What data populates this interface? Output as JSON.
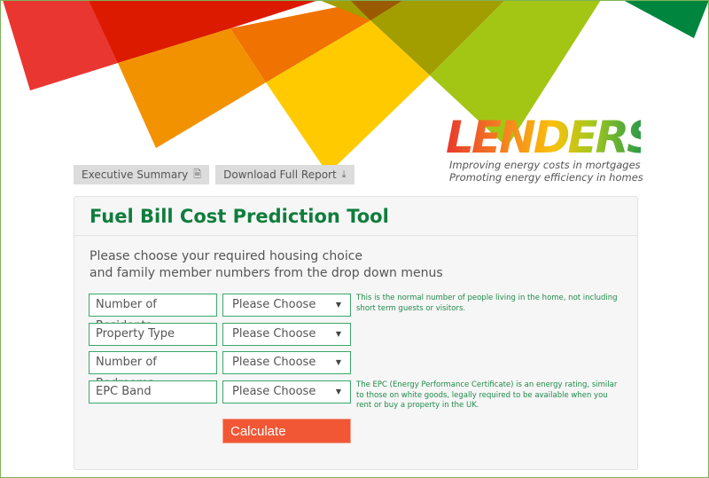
{
  "brand": {
    "name": "LENDERS",
    "tagline_1": "Improving energy costs in mortgages",
    "tagline_2": "Promoting energy efficiency in homes"
  },
  "top_buttons": [
    {
      "label": "Executive Summary",
      "icon": "document-icon"
    },
    {
      "label": "Download Full Report",
      "icon": "download-icon"
    }
  ],
  "tool": {
    "title": "Fuel Bill Cost Prediction Tool",
    "intro_line_1": "Please choose your required housing choice",
    "intro_line_2": "and family member numbers from the drop down menus",
    "fields": [
      {
        "label": "Number of Residents",
        "selected": "Please Choose",
        "help": "This is the normal number of people living in the home, not including short term guests or visitors."
      },
      {
        "label": "Property Type",
        "selected": "Please Choose",
        "help": ""
      },
      {
        "label": "Number of Bedrooms",
        "selected": "Please Choose",
        "help": ""
      },
      {
        "label": "EPC Band",
        "selected": "Please Choose",
        "help": "The EPC (Energy Performance Certificate) is an energy rating, similar to those on white goods, legally required to be available when you rent or buy a property in the UK."
      }
    ],
    "calculate_label": "Calculate"
  },
  "colors": {
    "brand_green": "#0f7d3c",
    "field_border": "#3aa86a",
    "calculate": "#f15735",
    "frame": "#7cb35a"
  }
}
